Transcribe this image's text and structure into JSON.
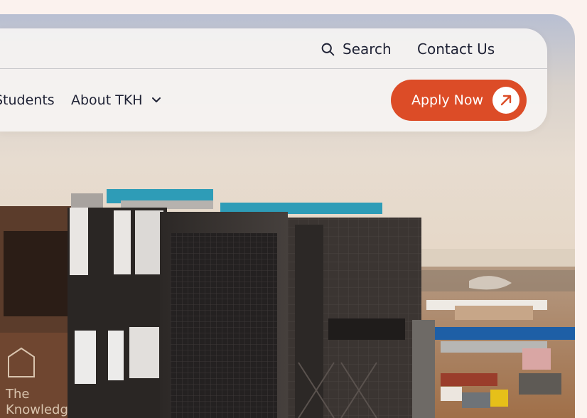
{
  "header": {
    "search_label": "Search",
    "contact_label": "Contact Us",
    "students_label": "Students",
    "about_label": "About TKH",
    "apply_label": "Apply Now"
  },
  "hero": {
    "sign_line1": "The",
    "sign_line2": "Knowledge"
  },
  "colors": {
    "accent": "#dc4c27",
    "nav_text": "#1f2235",
    "page_background": "#fbf2ee"
  },
  "icons": {
    "search": "search-icon",
    "dropdown": "chevron-down-icon",
    "apply": "arrow-up-right-icon"
  }
}
